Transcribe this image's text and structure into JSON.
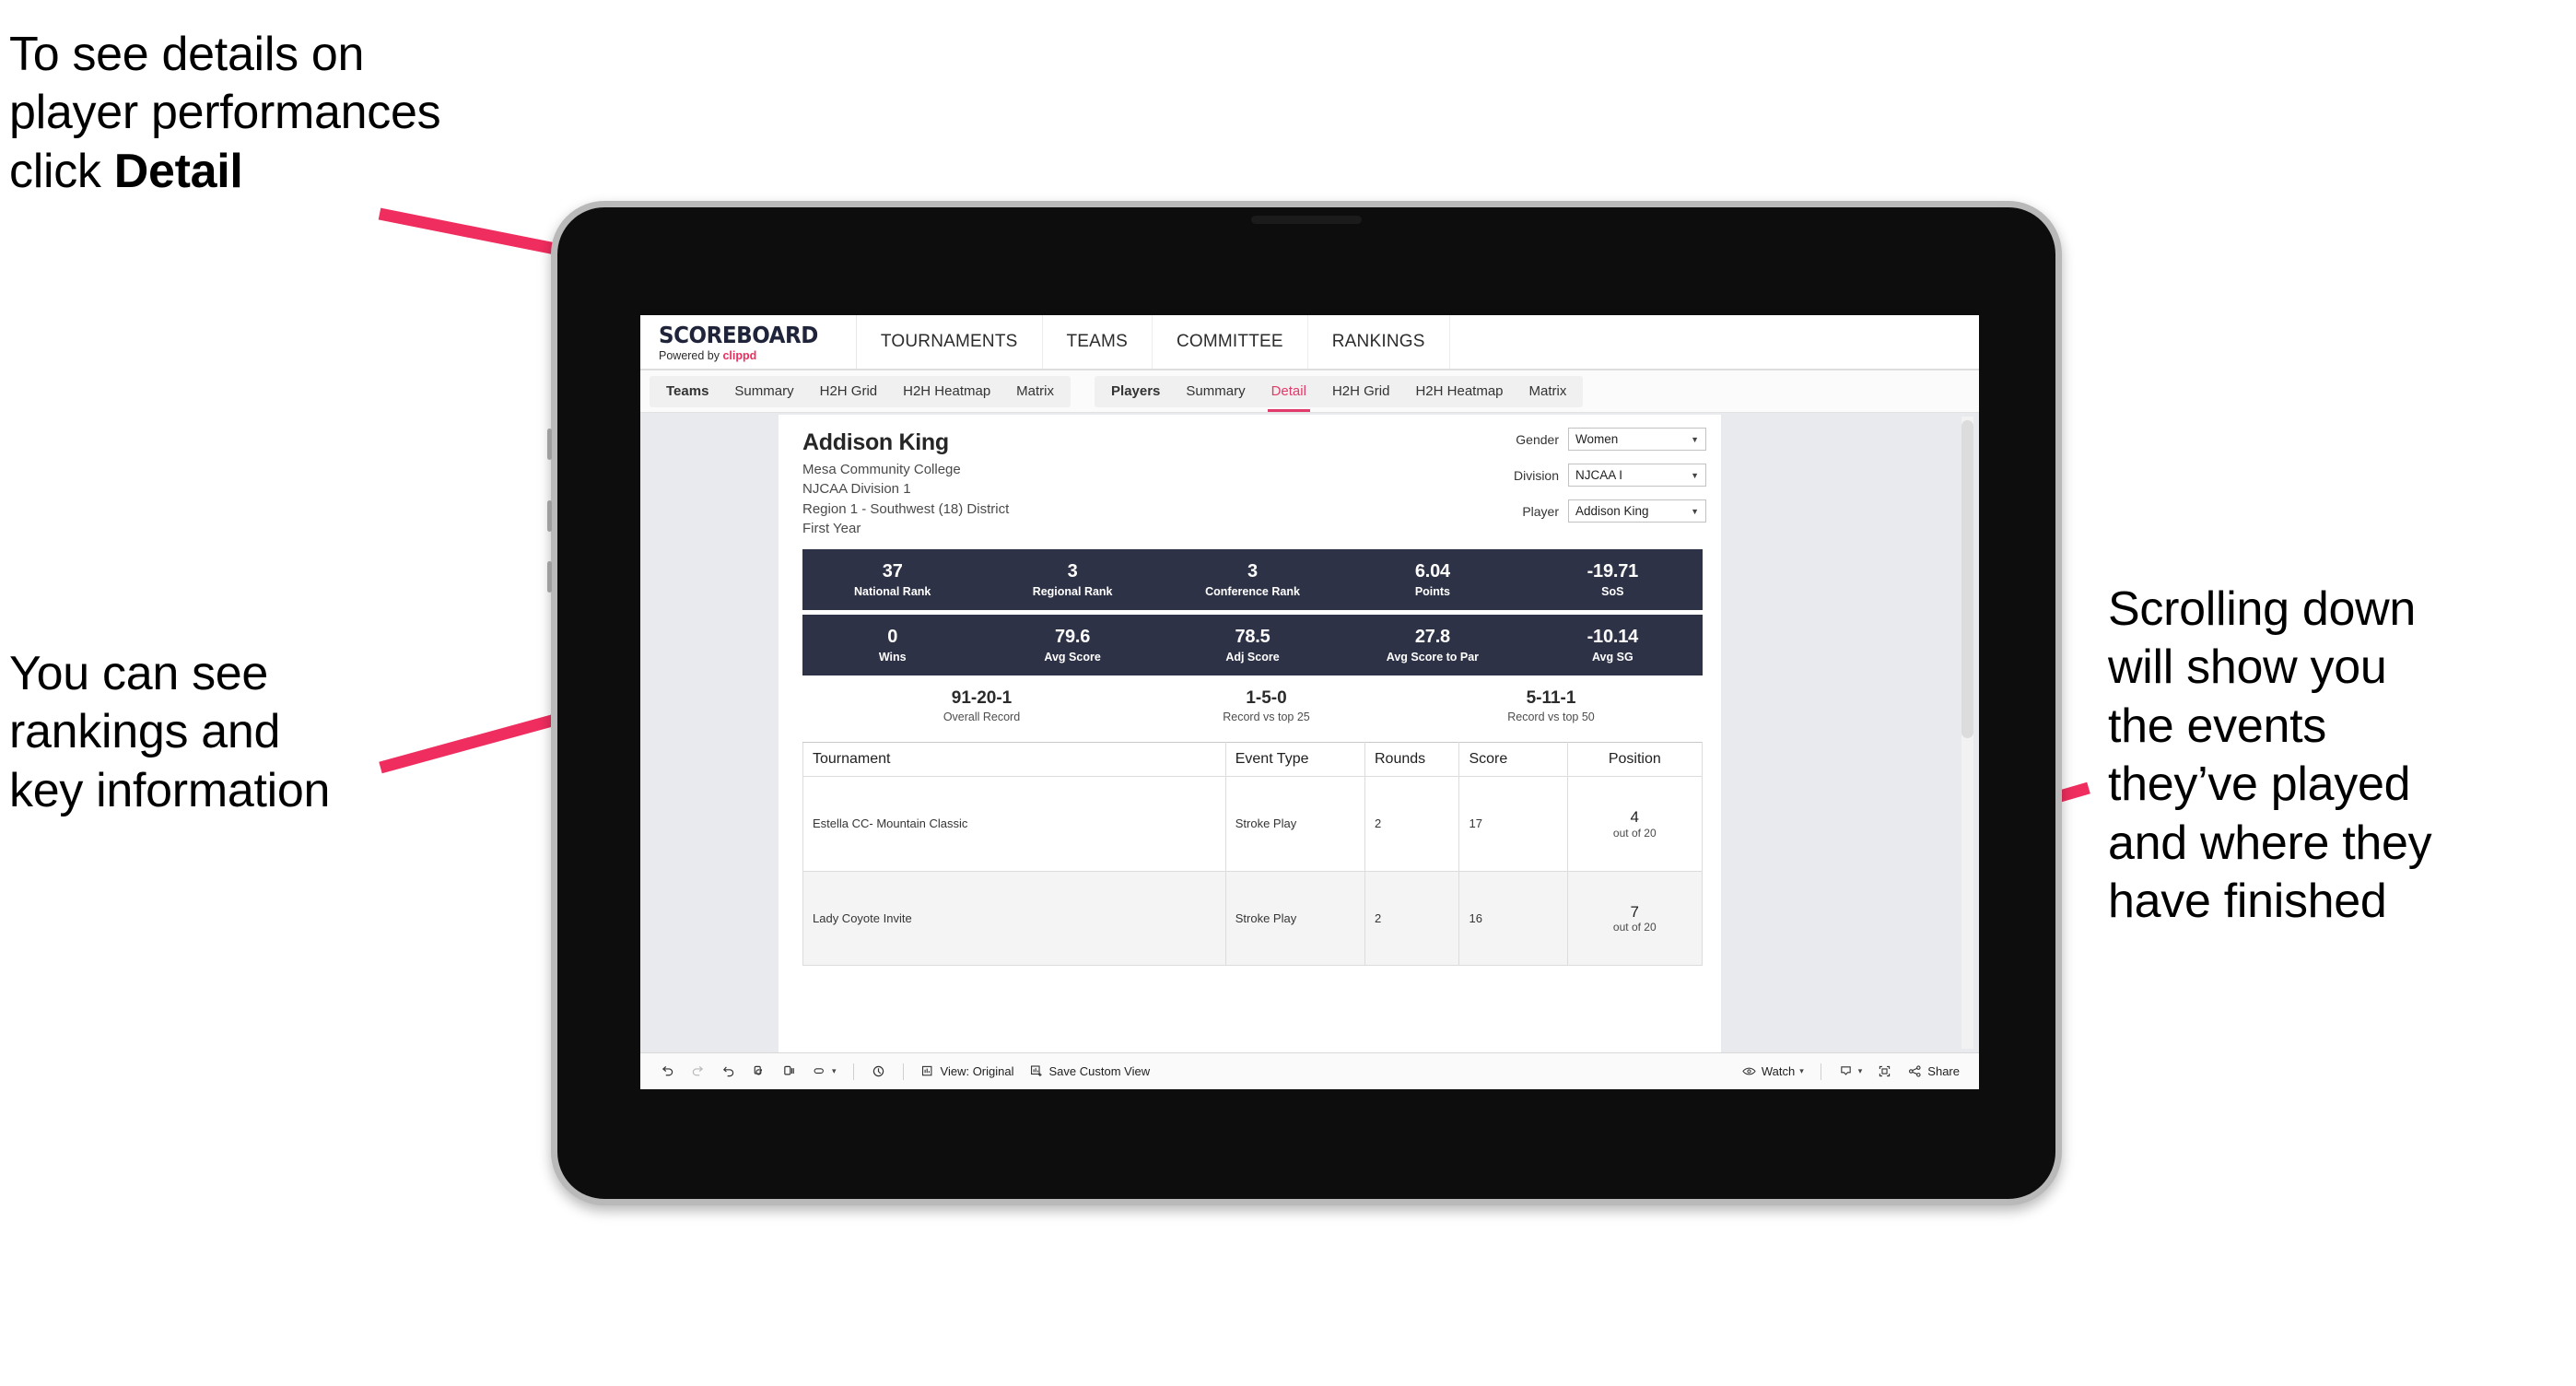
{
  "annotations": {
    "top_left": "To see details on\nplayer performances\nclick ",
    "top_left_bold": "Detail",
    "mid_left": "You can see\nrankings and\nkey information",
    "right": "Scrolling down\nwill show you\nthe events\nthey’ve played\nand where they\nhave finished"
  },
  "colors": {
    "accent_pink": "#ef2d5e",
    "band_navy": "#2e3246",
    "active_tab": "#e23a6a",
    "screen_bg": "#e8eaed"
  },
  "app": {
    "logo_main": "SCOREBOARD",
    "logo_sub_prefix": "Powered by ",
    "logo_sub_brand": "clippd",
    "main_nav": [
      {
        "label": "TOURNAMENTS"
      },
      {
        "label": "TEAMS"
      },
      {
        "label": "COMMITTEE"
      },
      {
        "label": "RANKINGS"
      }
    ],
    "subnav": {
      "teams_group": [
        {
          "label": "Teams",
          "lead": true,
          "active": false
        },
        {
          "label": "Summary",
          "lead": false,
          "active": false
        },
        {
          "label": "H2H Grid",
          "lead": false,
          "active": false
        },
        {
          "label": "H2H Heatmap",
          "lead": false,
          "active": false
        },
        {
          "label": "Matrix",
          "lead": false,
          "active": false
        }
      ],
      "players_group": [
        {
          "label": "Players",
          "lead": true,
          "active": false
        },
        {
          "label": "Summary",
          "lead": false,
          "active": false
        },
        {
          "label": "Detail",
          "lead": false,
          "active": true
        },
        {
          "label": "H2H Grid",
          "lead": false,
          "active": false
        },
        {
          "label": "H2H Heatmap",
          "lead": false,
          "active": false
        },
        {
          "label": "Matrix",
          "lead": false,
          "active": false
        }
      ]
    }
  },
  "player": {
    "name": "Addison King",
    "school": "Mesa Community College",
    "division": "NJCAA Division 1",
    "region": "Region 1 - Southwest (18) District",
    "year": "First Year"
  },
  "filters": [
    {
      "label": "Gender",
      "value": "Women"
    },
    {
      "label": "Division",
      "value": "NJCAA I"
    },
    {
      "label": "Player",
      "value": "Addison King"
    }
  ],
  "stats_band_1": [
    {
      "value": "37",
      "label": "National Rank"
    },
    {
      "value": "3",
      "label": "Regional Rank"
    },
    {
      "value": "3",
      "label": "Conference Rank"
    },
    {
      "value": "6.04",
      "label": "Points"
    },
    {
      "value": "-19.71",
      "label": "SoS"
    }
  ],
  "stats_band_2": [
    {
      "value": "0",
      "label": "Wins"
    },
    {
      "value": "79.6",
      "label": "Avg Score"
    },
    {
      "value": "78.5",
      "label": "Adj Score"
    },
    {
      "value": "27.8",
      "label": "Avg Score to Par"
    },
    {
      "value": "-10.14",
      "label": "Avg SG"
    }
  ],
  "records": [
    {
      "value": "91-20-1",
      "label": "Overall Record"
    },
    {
      "value": "1-5-0",
      "label": "Record vs top 25"
    },
    {
      "value": "5-11-1",
      "label": "Record vs top 50"
    }
  ],
  "events_table": {
    "headers": [
      "Tournament",
      "Event Type",
      "Rounds",
      "Score",
      "Position"
    ],
    "rows": [
      {
        "tournament": "Estella CC- Mountain Classic",
        "event_type": "Stroke Play",
        "rounds": "2",
        "score": "17",
        "position_num": "4",
        "position_of": "out of 20"
      },
      {
        "tournament": "Lady Coyote Invite",
        "event_type": "Stroke Play",
        "rounds": "2",
        "score": "16",
        "position_num": "7",
        "position_of": "out of 20"
      }
    ]
  },
  "toolbar": {
    "view_label": "View: Original",
    "save_view_label": "Save Custom View",
    "watch_label": "Watch",
    "share_label": "Share",
    "icons": [
      "undo-icon",
      "redo-icon",
      "revert-icon",
      "refresh-icon",
      "pause-icon",
      "highlight-icon",
      "dropdown-caret-icon",
      "clock-icon",
      "view-original-icon",
      "save-custom-view-icon",
      "eye-icon",
      "download-icon",
      "fullscreen-icon",
      "share-icon"
    ]
  }
}
